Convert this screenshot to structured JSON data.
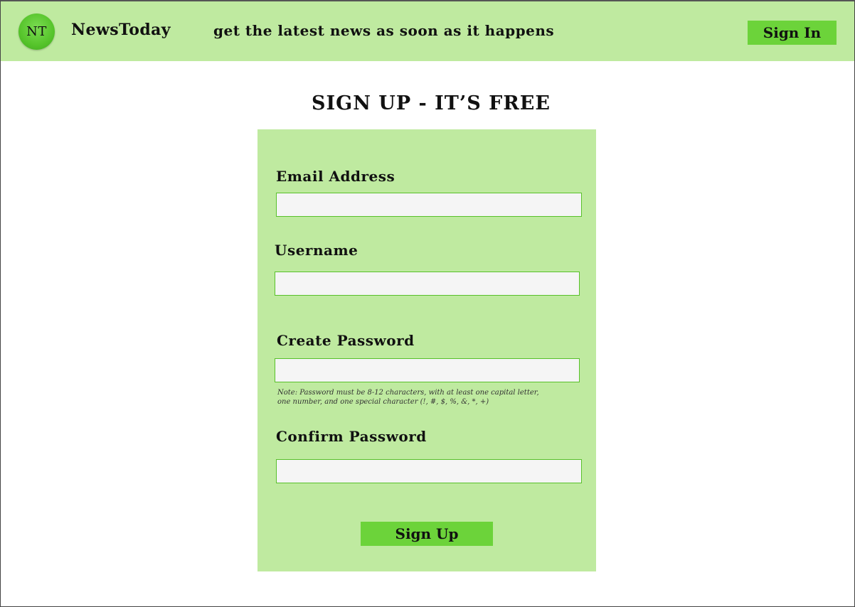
{
  "header": {
    "logo_text": "NT",
    "brand": "NewsToday",
    "tagline": "get the latest news as soon as it happens",
    "signin_label": "Sign In",
    "background": "#bfeaa0",
    "accent": "#6cd33a"
  },
  "main": {
    "title": "SIGN UP - IT’S FREE"
  },
  "form": {
    "email_label": "Email Address",
    "email_value": "",
    "username_label": "Username",
    "username_value": "",
    "password_label": "Create Password",
    "password_value": "",
    "password_note_line1": "Note: Password must be 8-12 characters, with at least one capital letter,",
    "password_note_line2": "one number, and one special character (!, #, $, %, &, *, +)",
    "confirm_label": "Confirm Password",
    "confirm_value": "",
    "submit_label": "Sign Up"
  }
}
